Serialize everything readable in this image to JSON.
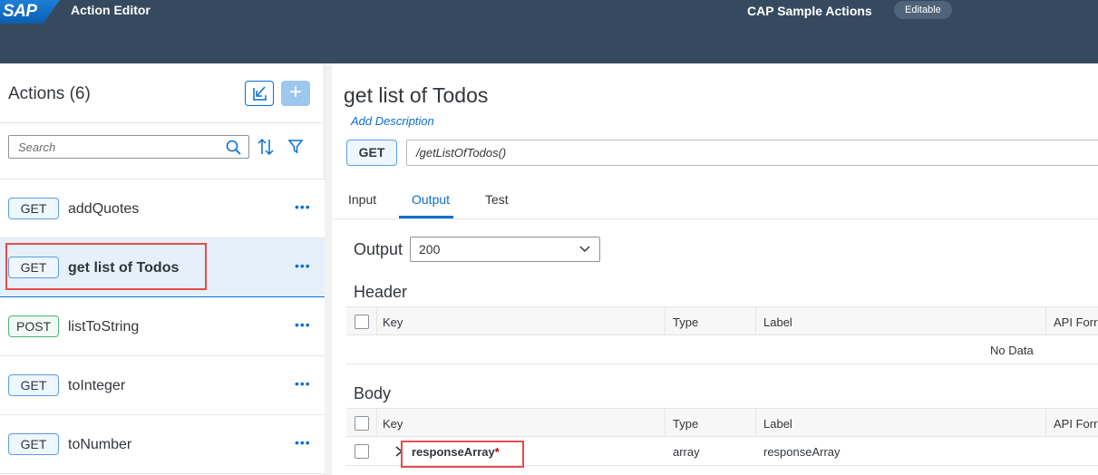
{
  "shell": {
    "logo": "SAP",
    "app_title": "Action Editor",
    "project_name": "CAP Sample Actions",
    "status_badge": "Editable"
  },
  "left": {
    "title": "Actions (6)",
    "search_placeholder": "Search",
    "items": [
      {
        "method": "GET",
        "label": "addQuotes"
      },
      {
        "method": "GET",
        "label": "get list of Todos",
        "selected": true
      },
      {
        "method": "POST",
        "label": "listToString"
      },
      {
        "method": "GET",
        "label": "toInteger"
      },
      {
        "method": "GET",
        "label": "toNumber"
      }
    ],
    "more_glyph": "•••"
  },
  "detail": {
    "title": "get list of Todos",
    "add_description": "Add Description",
    "method": "GET",
    "path": "/getListOfTodos()",
    "tabs": [
      {
        "label": "Input"
      },
      {
        "label": "Output",
        "active": true
      },
      {
        "label": "Test"
      }
    ],
    "output_label": "Output",
    "output_value": "200",
    "header_section": {
      "title": "Header",
      "columns": [
        "Key",
        "Type",
        "Label",
        "API Forr"
      ],
      "no_data": "No Data"
    },
    "body_section": {
      "title": "Body",
      "columns": [
        "Key",
        "Type",
        "Label",
        "API Forr"
      ],
      "rows": [
        {
          "key": "responseArray",
          "required_mark": "*",
          "type": "array",
          "label": "responseArray"
        }
      ]
    }
  },
  "colors": {
    "shell_bg": "#354a5f",
    "accent": "#0a6ed1",
    "highlight": "#e74c4c",
    "selected_row": "#e5f0fa",
    "post_border": "#50b57c"
  }
}
